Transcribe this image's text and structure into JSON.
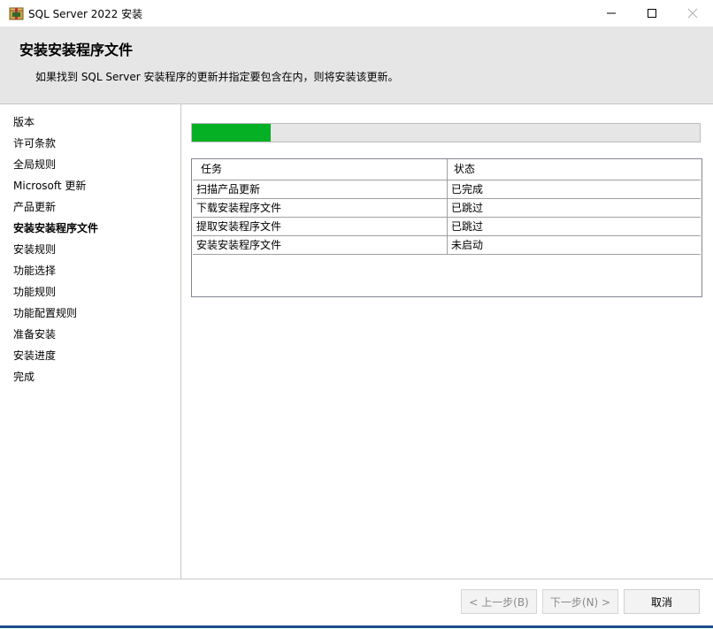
{
  "window": {
    "title": "SQL Server 2022 安装"
  },
  "header": {
    "title": "安装安装程序文件",
    "subtitle": "如果找到 SQL Server 安装程序的更新并指定要包含在内，则将安装该更新。"
  },
  "sidebar": {
    "items": [
      {
        "label": "版本",
        "active": false
      },
      {
        "label": "许可条款",
        "active": false
      },
      {
        "label": "全局规则",
        "active": false
      },
      {
        "label": "Microsoft 更新",
        "active": false
      },
      {
        "label": "产品更新",
        "active": false
      },
      {
        "label": "安装安装程序文件",
        "active": true
      },
      {
        "label": "安装规则",
        "active": false
      },
      {
        "label": "功能选择",
        "active": false
      },
      {
        "label": "功能规则",
        "active": false
      },
      {
        "label": "功能配置规则",
        "active": false
      },
      {
        "label": "准备安装",
        "active": false
      },
      {
        "label": "安装进度",
        "active": false
      },
      {
        "label": "完成",
        "active": false
      }
    ]
  },
  "progress": {
    "fraction": 0.155,
    "color": "#06b025"
  },
  "table": {
    "headers": [
      "任务",
      "状态"
    ],
    "rows": [
      [
        "扫描产品更新",
        "已完成"
      ],
      [
        "下载安装程序文件",
        "已跳过"
      ],
      [
        "提取安装程序文件",
        "已跳过"
      ],
      [
        "安装安装程序文件",
        "未启动"
      ]
    ]
  },
  "footer": {
    "back_label": "< 上一步(B)",
    "next_label": "下一步(N) >",
    "cancel_label": "取消"
  },
  "icons": {
    "app": "sql-server-setup-icon",
    "minimize": "minimize-icon",
    "maximize": "maximize-icon",
    "close": "close-icon"
  }
}
